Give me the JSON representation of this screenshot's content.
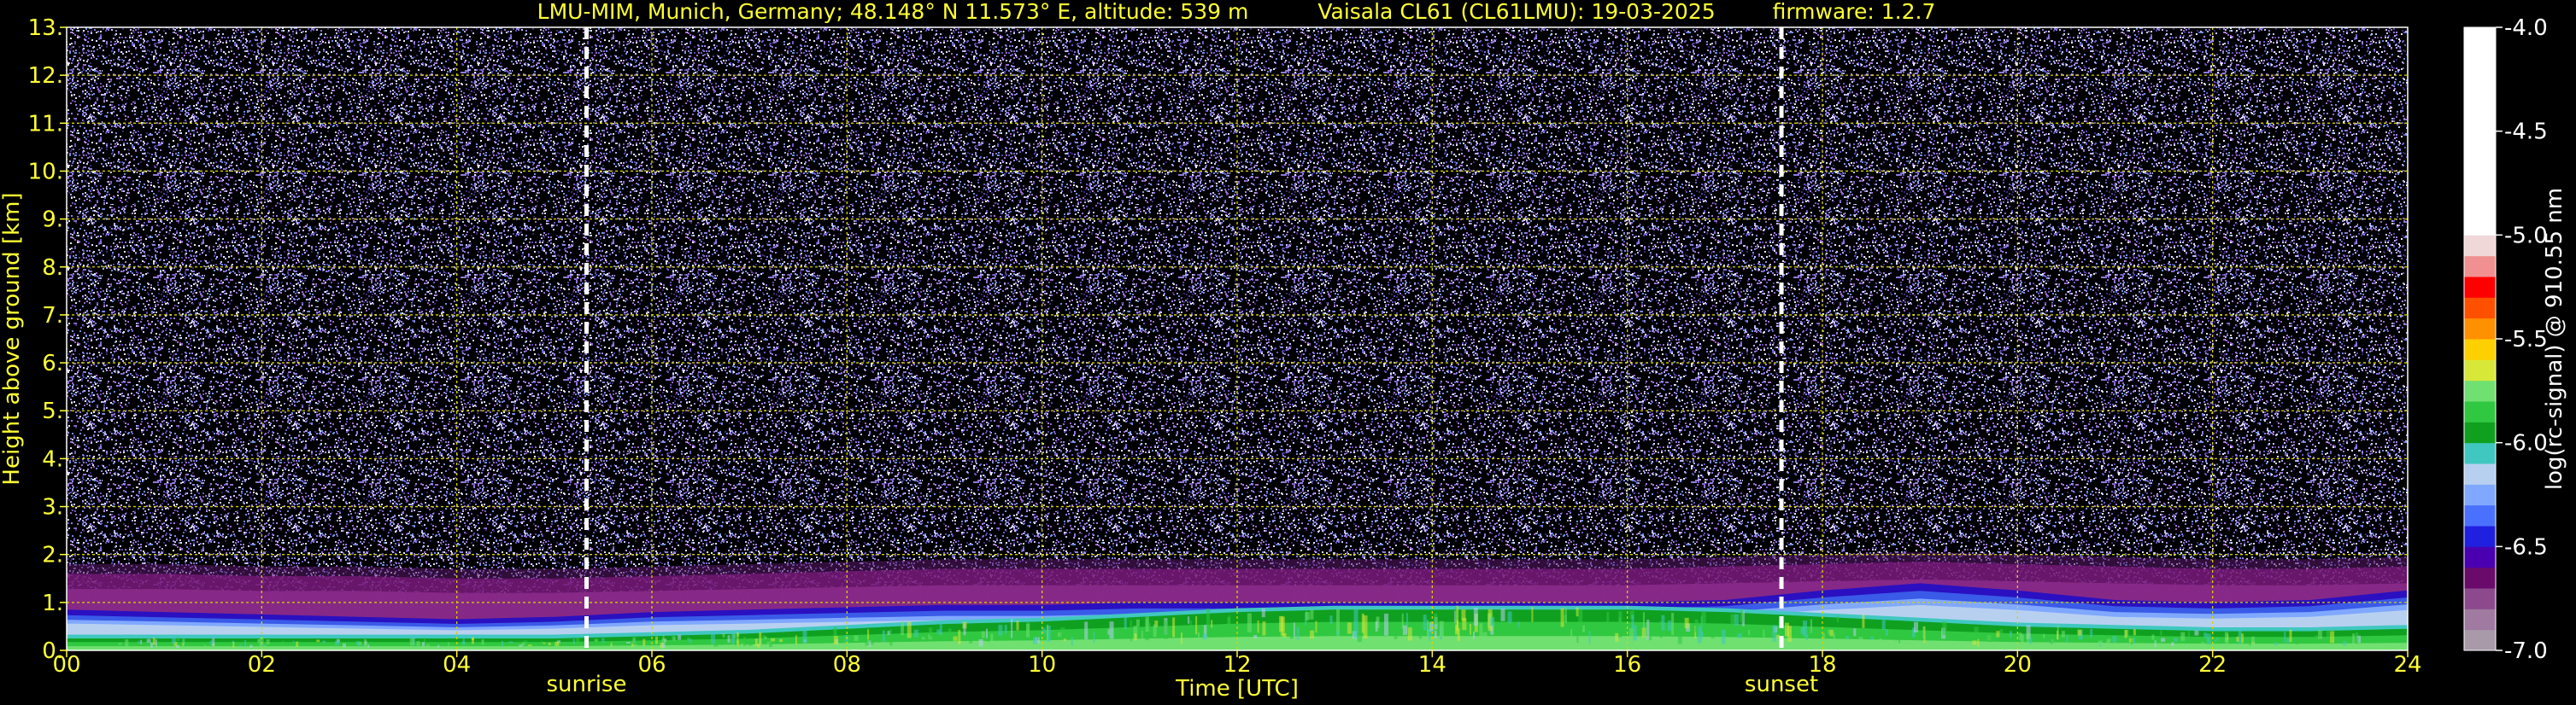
{
  "chart_data": {
    "type": "heatmap",
    "title_parts": {
      "site": "LMU-MIM, Munich, Germany; 48.148° N 11.573° E, altitude: 539 m",
      "instrument": "Vaisala CL61 (CL61LMU): 19-03-2025",
      "firmware": "firmware: 1.2.7"
    },
    "xlabel": "Time [UTC]",
    "ylabel": "Height above ground [km]",
    "xlim": [
      0,
      24
    ],
    "ylim": [
      0,
      13
    ],
    "x_ticks": [
      "00",
      "02",
      "04",
      "06",
      "08",
      "10",
      "12",
      "14",
      "16",
      "18",
      "20",
      "22",
      "24"
    ],
    "y_ticks": [
      "0.",
      "1.",
      "2.",
      "3.",
      "4.",
      "5.",
      "6.",
      "7.",
      "8.",
      "9.",
      "10.",
      "11.",
      "12.",
      "13."
    ],
    "grid": true,
    "markers": [
      {
        "label": "sunrise",
        "x": 5.33
      },
      {
        "label": "sunset",
        "x": 17.58
      }
    ],
    "boundary_layer": {
      "x": [
        0,
        1,
        2,
        3,
        4,
        5,
        6,
        7,
        8,
        9,
        10,
        11,
        12,
        13,
        14,
        15,
        16,
        17,
        18,
        19,
        20,
        21,
        22,
        23,
        24
      ],
      "aerosol_top_km": [
        0.8,
        0.75,
        0.7,
        0.65,
        0.6,
        0.65,
        0.75,
        0.8,
        0.85,
        0.9,
        0.9,
        0.95,
        0.95,
        0.95,
        0.95,
        0.95,
        0.95,
        1.0,
        1.2,
        1.35,
        1.2,
        1.0,
        0.95,
        1.0,
        1.2
      ],
      "dense_layer_top_km": [
        0.25,
        0.25,
        0.25,
        0.25,
        0.25,
        0.25,
        0.3,
        0.35,
        0.45,
        0.55,
        0.6,
        0.7,
        0.8,
        0.85,
        0.85,
        0.85,
        0.85,
        0.8,
        0.7,
        0.6,
        0.5,
        0.45,
        0.4,
        0.4,
        0.45
      ],
      "residual_top_km": [
        1.6,
        1.6,
        1.55,
        1.55,
        1.5,
        1.5,
        1.55,
        1.6,
        1.65,
        1.7,
        1.7,
        1.7,
        1.7,
        1.7,
        1.7,
        1.7,
        1.7,
        1.75,
        1.8,
        1.85,
        1.8,
        1.75,
        1.7,
        1.7,
        1.75
      ]
    },
    "colorbar": {
      "label": "log(rc-signal) @ 910.55 nm",
      "ticks": [
        "-4.0",
        "-4.5",
        "-5.0",
        "-5.5",
        "-6.0",
        "-6.5",
        "-7.0"
      ],
      "range": [
        -7.0,
        -4.0
      ],
      "colors": [
        {
          "from": -7.0,
          "to": -6.9,
          "color": "#a89aa8"
        },
        {
          "from": -6.9,
          "to": -6.8,
          "color": "#a07aa0"
        },
        {
          "from": -6.8,
          "to": -6.7,
          "color": "#8c4a8c"
        },
        {
          "from": -6.7,
          "to": -6.6,
          "color": "#6a0a6a"
        },
        {
          "from": -6.6,
          "to": -6.5,
          "color": "#4a00b0"
        },
        {
          "from": -6.5,
          "to": -6.4,
          "color": "#2020e0"
        },
        {
          "from": -6.4,
          "to": -6.3,
          "color": "#4a70ff"
        },
        {
          "from": -6.3,
          "to": -6.2,
          "color": "#80a8ff"
        },
        {
          "from": -6.2,
          "to": -6.1,
          "color": "#b8d0f0"
        },
        {
          "from": -6.1,
          "to": -6.0,
          "color": "#40c8c0"
        },
        {
          "from": -6.0,
          "to": -5.9,
          "color": "#10a020"
        },
        {
          "from": -5.9,
          "to": -5.8,
          "color": "#30c840"
        },
        {
          "from": -5.8,
          "to": -5.7,
          "color": "#70e070"
        },
        {
          "from": -5.7,
          "to": -5.6,
          "color": "#d8e838"
        },
        {
          "from": -5.6,
          "to": -5.5,
          "color": "#ffd000"
        },
        {
          "from": -5.5,
          "to": -5.4,
          "color": "#ff9000"
        },
        {
          "from": -5.4,
          "to": -5.3,
          "color": "#ff5000"
        },
        {
          "from": -5.3,
          "to": -5.2,
          "color": "#ff0000"
        },
        {
          "from": -5.2,
          "to": -5.1,
          "color": "#f09090"
        },
        {
          "from": -5.1,
          "to": -5.0,
          "color": "#f0d8d8"
        },
        {
          "from": -5.0,
          "to": -4.0,
          "color": "#ffffff"
        }
      ]
    }
  },
  "colors": {
    "text": "#ffff33",
    "grid": "#d4d400",
    "background": "#000000",
    "noise_base": "#35224e",
    "markers": "#ffffff"
  }
}
